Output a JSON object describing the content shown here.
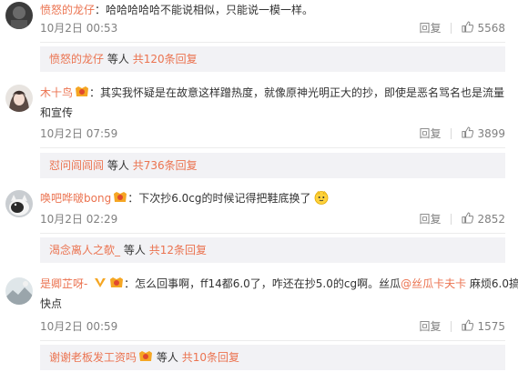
{
  "labels": {
    "reply": "回复",
    "others": "等人"
  },
  "colors": {
    "link": "#eb7350",
    "reply_bg": "#f2f2f5",
    "meta": "#808080"
  },
  "comments": [
    {
      "user": "愤怒的龙仔",
      "text": "：哈哈哈哈哈不能说相似，只能说一模一样。",
      "time": "10月2日 00:53",
      "likes": "5568",
      "reply_user": "愤怒的龙仔",
      "reply_total": "共120条回复",
      "avatar_icon": "dark-avatar"
    },
    {
      "user": "木十鸟",
      "text": "：其实我怀疑是在故意这样蹭热度，就像原神光明正大的抄，即使是恶名骂名也是流量",
      "text_line2": "和宣传",
      "time": "10月2日 07:59",
      "likes": "3899",
      "reply_user": "怼问闾闾闾",
      "reply_total": "共736条回复",
      "avatar_icon": "anime-avatar"
    },
    {
      "user": "唤吧哗啵bong",
      "text": "：下次抄6.0cg的时候记得把鞋底换了",
      "time": "10月2日 02:29",
      "likes": "2852",
      "reply_user": "渴念离人之欹_",
      "reply_total": "共12条回复",
      "avatar_icon": "cat-avatar"
    },
    {
      "user": "是卿芷呀-",
      "text_a": "：怎么回事啊，ff14都6.0了，咋还在抄5.0的cg啊。丝瓜",
      "mention": "@丝瓜卡夫卡",
      "text_b": " 麻烦6.0搞",
      "text_line2": "快点",
      "time": "10月2日 00:59",
      "likes": "1575",
      "reply_user": "谢谢老板发工资吗",
      "reply_total": "共10条回复",
      "avatar_icon": "landscape-avatar"
    }
  ]
}
